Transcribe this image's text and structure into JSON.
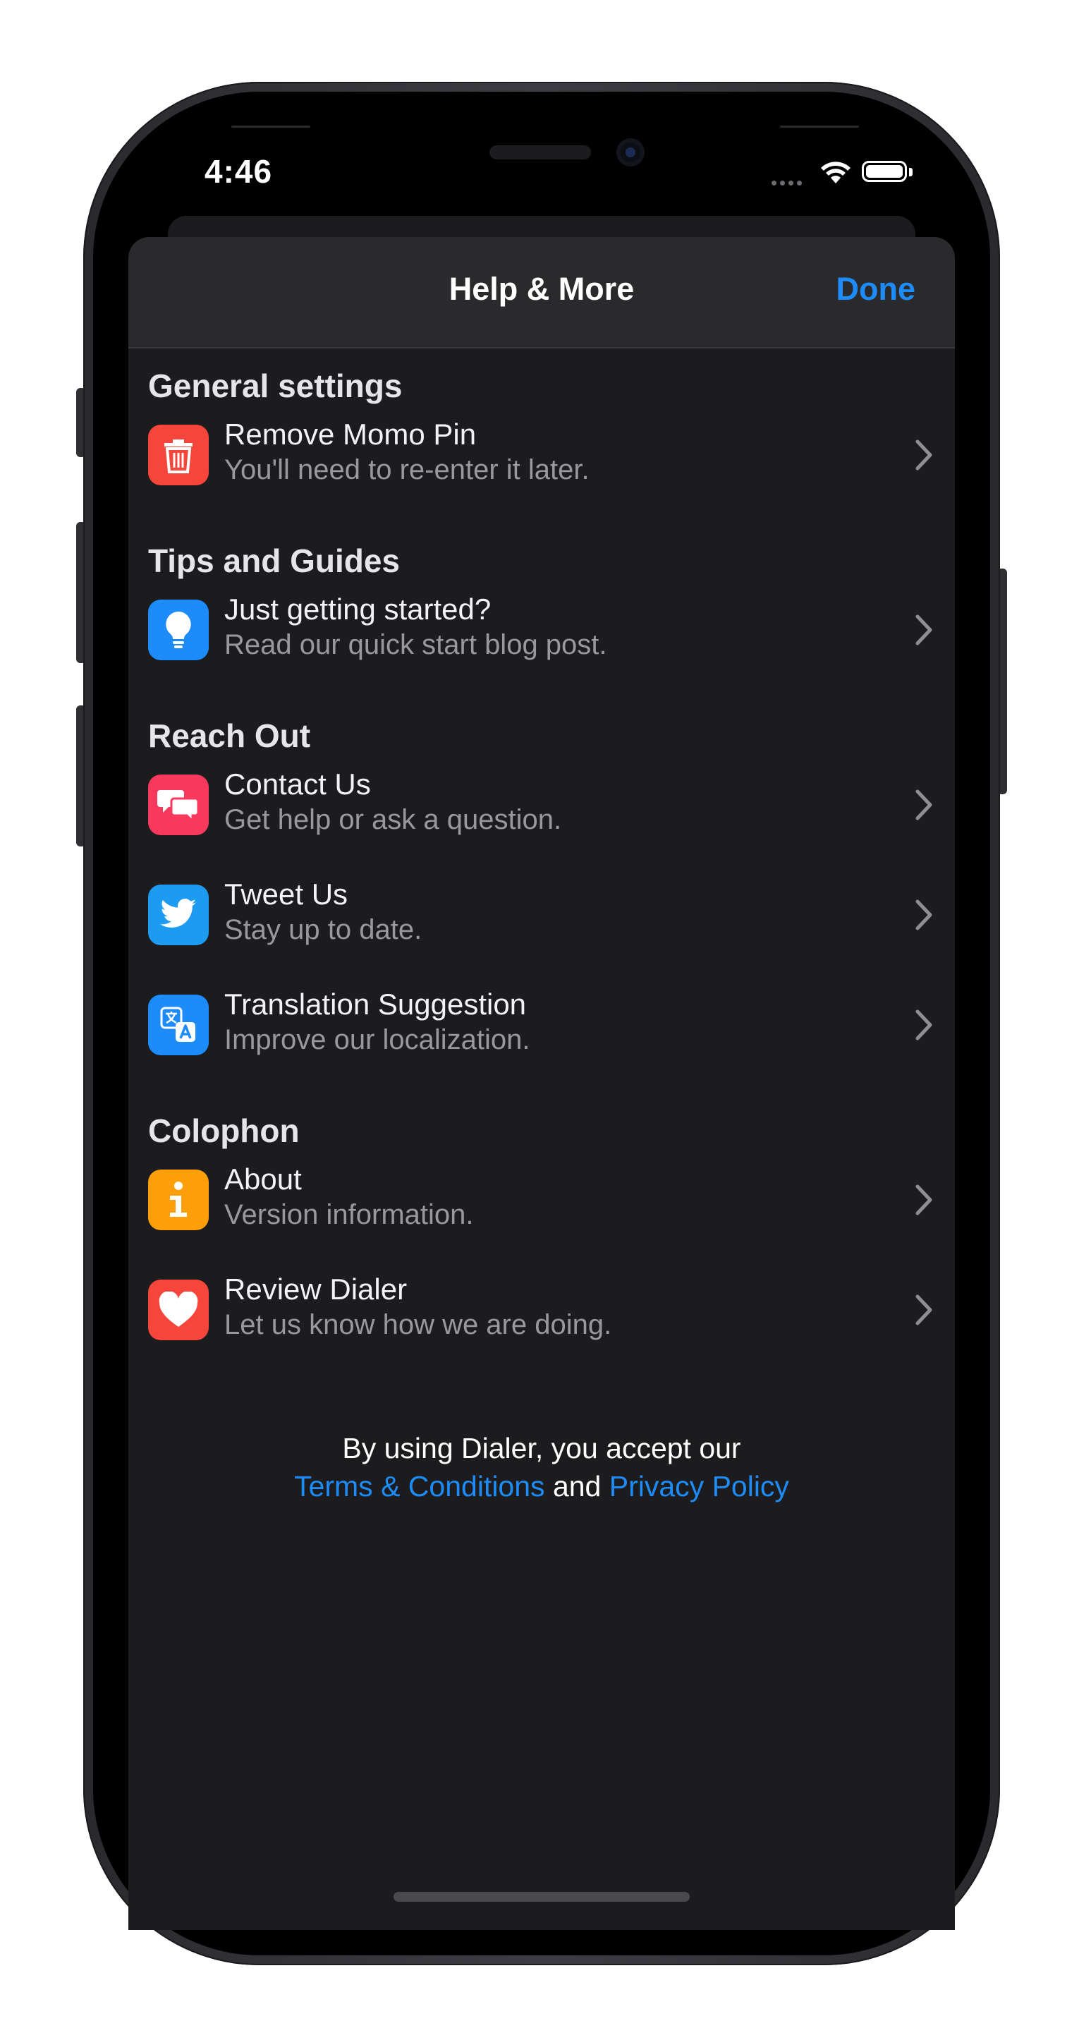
{
  "status_bar": {
    "time": "4:46"
  },
  "navbar": {
    "title": "Help & More",
    "done_label": "Done"
  },
  "sections": [
    {
      "header": "General settings",
      "rows": [
        {
          "title": "Remove Momo Pin",
          "subtitle": "You'll need to re-enter it later.",
          "icon": "trash-icon",
          "color": "#f6453a"
        }
      ]
    },
    {
      "header": "Tips and Guides",
      "rows": [
        {
          "title": "Just getting started?",
          "subtitle": "Read our quick start blog post.",
          "icon": "lightbulb-icon",
          "color": "#1d8cf8"
        }
      ]
    },
    {
      "header": "Reach Out",
      "rows": [
        {
          "title": "Contact Us",
          "subtitle": "Get help or ask a question.",
          "icon": "chat-bubbles-icon",
          "color": "#f6395c"
        },
        {
          "title": "Tweet Us",
          "subtitle": "Stay up to date.",
          "icon": "twitter-bird-icon",
          "color": "#1d9bf0"
        },
        {
          "title": "Translation Suggestion",
          "subtitle": "Improve our localization.",
          "icon": "translate-icon",
          "color": "#1d8cf8"
        }
      ]
    },
    {
      "header": "Colophon",
      "rows": [
        {
          "title": "About",
          "subtitle": "Version information.",
          "icon": "info-icon",
          "color": "#ff9f0a"
        },
        {
          "title": "Review Dialer",
          "subtitle": "Let us know how we are doing.",
          "icon": "heart-icon",
          "color": "#f6453a"
        }
      ]
    }
  ],
  "footer": {
    "line1": "By using Dialer, you accept our",
    "terms_link": "Terms & Conditions",
    "and_text": "and",
    "privacy_link": "Privacy Policy"
  }
}
